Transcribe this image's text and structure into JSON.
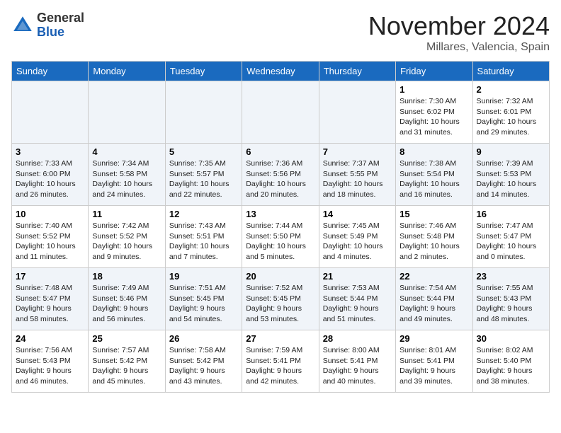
{
  "header": {
    "logo_general": "General",
    "logo_blue": "Blue",
    "month_title": "November 2024",
    "location": "Millares, Valencia, Spain"
  },
  "weekdays": [
    "Sunday",
    "Monday",
    "Tuesday",
    "Wednesday",
    "Thursday",
    "Friday",
    "Saturday"
  ],
  "weeks": [
    [
      {
        "day": "",
        "info": ""
      },
      {
        "day": "",
        "info": ""
      },
      {
        "day": "",
        "info": ""
      },
      {
        "day": "",
        "info": ""
      },
      {
        "day": "",
        "info": ""
      },
      {
        "day": "1",
        "info": "Sunrise: 7:30 AM\nSunset: 6:02 PM\nDaylight: 10 hours\nand 31 minutes."
      },
      {
        "day": "2",
        "info": "Sunrise: 7:32 AM\nSunset: 6:01 PM\nDaylight: 10 hours\nand 29 minutes."
      }
    ],
    [
      {
        "day": "3",
        "info": "Sunrise: 7:33 AM\nSunset: 6:00 PM\nDaylight: 10 hours\nand 26 minutes."
      },
      {
        "day": "4",
        "info": "Sunrise: 7:34 AM\nSunset: 5:58 PM\nDaylight: 10 hours\nand 24 minutes."
      },
      {
        "day": "5",
        "info": "Sunrise: 7:35 AM\nSunset: 5:57 PM\nDaylight: 10 hours\nand 22 minutes."
      },
      {
        "day": "6",
        "info": "Sunrise: 7:36 AM\nSunset: 5:56 PM\nDaylight: 10 hours\nand 20 minutes."
      },
      {
        "day": "7",
        "info": "Sunrise: 7:37 AM\nSunset: 5:55 PM\nDaylight: 10 hours\nand 18 minutes."
      },
      {
        "day": "8",
        "info": "Sunrise: 7:38 AM\nSunset: 5:54 PM\nDaylight: 10 hours\nand 16 minutes."
      },
      {
        "day": "9",
        "info": "Sunrise: 7:39 AM\nSunset: 5:53 PM\nDaylight: 10 hours\nand 14 minutes."
      }
    ],
    [
      {
        "day": "10",
        "info": "Sunrise: 7:40 AM\nSunset: 5:52 PM\nDaylight: 10 hours\nand 11 minutes."
      },
      {
        "day": "11",
        "info": "Sunrise: 7:42 AM\nSunset: 5:52 PM\nDaylight: 10 hours\nand 9 minutes."
      },
      {
        "day": "12",
        "info": "Sunrise: 7:43 AM\nSunset: 5:51 PM\nDaylight: 10 hours\nand 7 minutes."
      },
      {
        "day": "13",
        "info": "Sunrise: 7:44 AM\nSunset: 5:50 PM\nDaylight: 10 hours\nand 5 minutes."
      },
      {
        "day": "14",
        "info": "Sunrise: 7:45 AM\nSunset: 5:49 PM\nDaylight: 10 hours\nand 4 minutes."
      },
      {
        "day": "15",
        "info": "Sunrise: 7:46 AM\nSunset: 5:48 PM\nDaylight: 10 hours\nand 2 minutes."
      },
      {
        "day": "16",
        "info": "Sunrise: 7:47 AM\nSunset: 5:47 PM\nDaylight: 10 hours\nand 0 minutes."
      }
    ],
    [
      {
        "day": "17",
        "info": "Sunrise: 7:48 AM\nSunset: 5:47 PM\nDaylight: 9 hours\nand 58 minutes."
      },
      {
        "day": "18",
        "info": "Sunrise: 7:49 AM\nSunset: 5:46 PM\nDaylight: 9 hours\nand 56 minutes."
      },
      {
        "day": "19",
        "info": "Sunrise: 7:51 AM\nSunset: 5:45 PM\nDaylight: 9 hours\nand 54 minutes."
      },
      {
        "day": "20",
        "info": "Sunrise: 7:52 AM\nSunset: 5:45 PM\nDaylight: 9 hours\nand 53 minutes."
      },
      {
        "day": "21",
        "info": "Sunrise: 7:53 AM\nSunset: 5:44 PM\nDaylight: 9 hours\nand 51 minutes."
      },
      {
        "day": "22",
        "info": "Sunrise: 7:54 AM\nSunset: 5:44 PM\nDaylight: 9 hours\nand 49 minutes."
      },
      {
        "day": "23",
        "info": "Sunrise: 7:55 AM\nSunset: 5:43 PM\nDaylight: 9 hours\nand 48 minutes."
      }
    ],
    [
      {
        "day": "24",
        "info": "Sunrise: 7:56 AM\nSunset: 5:43 PM\nDaylight: 9 hours\nand 46 minutes."
      },
      {
        "day": "25",
        "info": "Sunrise: 7:57 AM\nSunset: 5:42 PM\nDaylight: 9 hours\nand 45 minutes."
      },
      {
        "day": "26",
        "info": "Sunrise: 7:58 AM\nSunset: 5:42 PM\nDaylight: 9 hours\nand 43 minutes."
      },
      {
        "day": "27",
        "info": "Sunrise: 7:59 AM\nSunset: 5:41 PM\nDaylight: 9 hours\nand 42 minutes."
      },
      {
        "day": "28",
        "info": "Sunrise: 8:00 AM\nSunset: 5:41 PM\nDaylight: 9 hours\nand 40 minutes."
      },
      {
        "day": "29",
        "info": "Sunrise: 8:01 AM\nSunset: 5:41 PM\nDaylight: 9 hours\nand 39 minutes."
      },
      {
        "day": "30",
        "info": "Sunrise: 8:02 AM\nSunset: 5:40 PM\nDaylight: 9 hours\nand 38 minutes."
      }
    ]
  ]
}
